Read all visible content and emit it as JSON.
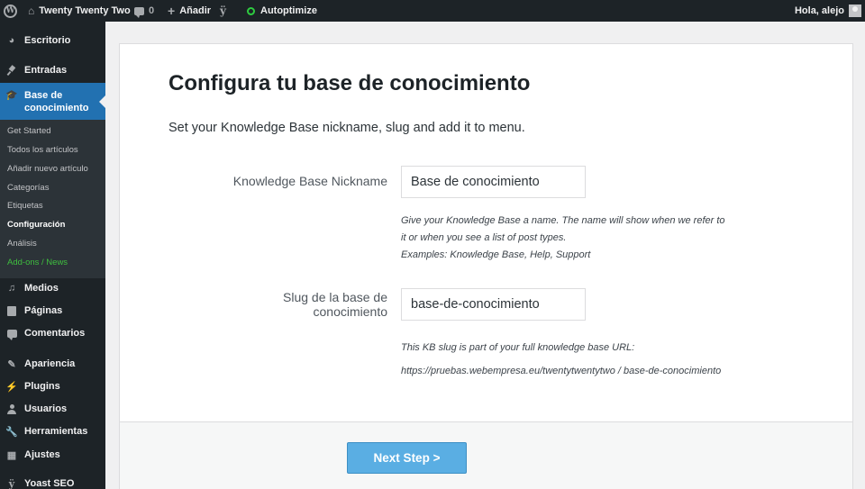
{
  "admin_bar": {
    "site_name": "Twenty Twenty Two",
    "comments_count": "0",
    "new_label": "Añadir",
    "autoptimize_label": "Autoptimize",
    "greeting": "Hola, alejo"
  },
  "sidebar": {
    "items": [
      {
        "label": "Escritorio",
        "icon": "dashboard-icon"
      },
      {
        "label": "Entradas",
        "icon": "pin-icon"
      },
      {
        "label": "Base de conocimiento",
        "icon": "graduation-cap-icon"
      },
      {
        "label": "Medios",
        "icon": "media-icon"
      },
      {
        "label": "Páginas",
        "icon": "pages-icon"
      },
      {
        "label": "Comentarios",
        "icon": "comment-icon"
      },
      {
        "label": "Apariencia",
        "icon": "paintbrush-icon"
      },
      {
        "label": "Plugins",
        "icon": "plugin-icon"
      },
      {
        "label": "Usuarios",
        "icon": "users-icon"
      },
      {
        "label": "Herramientas",
        "icon": "wrench-icon"
      },
      {
        "label": "Ajustes",
        "icon": "settings-icon"
      },
      {
        "label": "Yoast SEO",
        "icon": "yoast-icon"
      }
    ],
    "submenu": [
      "Get Started",
      "Todos los artículos",
      "Añadir nuevo artículo",
      "Categorías",
      "Etiquetas",
      "Configuración",
      "Análisis",
      "Add-ons / News"
    ]
  },
  "main": {
    "title": "Configura tu base de conocimiento",
    "intro": "Set your Knowledge Base nickname, slug and add it to menu.",
    "nickname": {
      "label": "Knowledge Base Nickname",
      "value": "Base de conocimiento",
      "help_line1": "Give your Knowledge Base a name. The name will show when we refer to",
      "help_line2": "it or when you see a list of post types.",
      "help_line3": "Examples: Knowledge Base, Help, Support"
    },
    "slug": {
      "label_line1": "Slug de la base de",
      "label_line2": "conocimiento",
      "value": "base-de-conocimiento",
      "help_line1": "This KB slug is part of your full knowledge base URL:",
      "help_line2": "https://pruebas.webempresa.eu/twentytwentytwo / base-de-conocimiento"
    },
    "next_button": "Next Step >"
  },
  "colors": {
    "admin_dark": "#1d2327",
    "submenu_bg": "#2c3338",
    "accent": "#2271b1",
    "button": "#5aaee3",
    "addons_green": "#3fbf3f"
  }
}
